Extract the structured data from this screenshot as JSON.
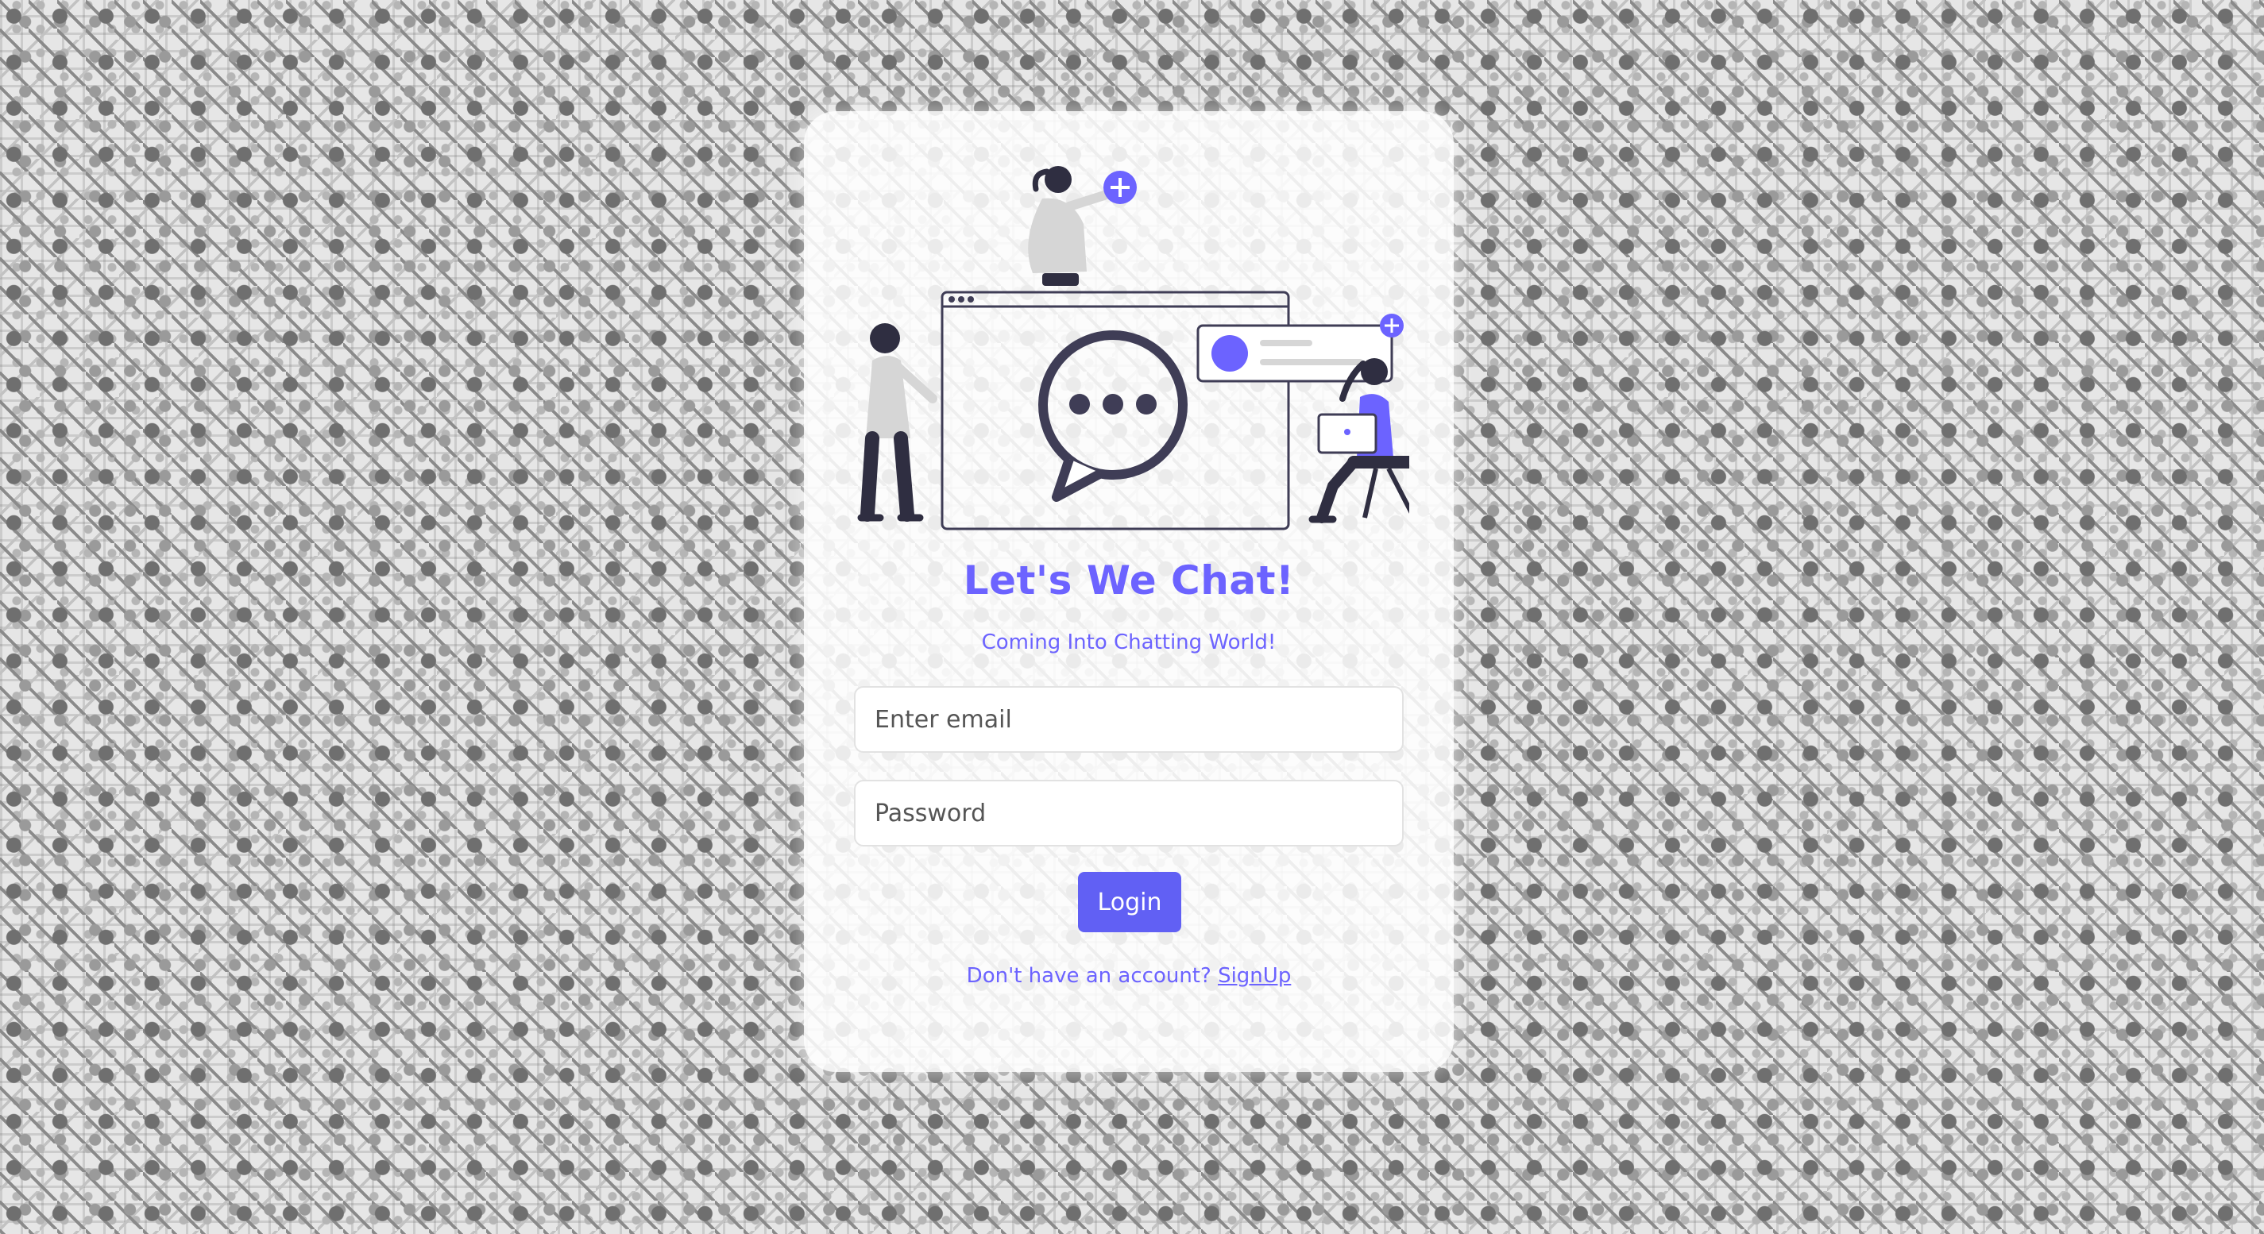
{
  "login": {
    "title": "Let's We Chat!",
    "subtitle": "Coming Into Chatting World!",
    "email_placeholder": "Enter email",
    "password_placeholder": "Password",
    "login_label": "Login",
    "signup_prompt": "Don't have an account?",
    "signup_link": "SignUp"
  },
  "illustration": {
    "icons": [
      "chat-bubble-icon",
      "plus-icon",
      "avatar-dot-icon"
    ]
  },
  "colors": {
    "accent": "#6c63ff",
    "button": "#6160f4",
    "dark": "#3f3d56",
    "light_gray": "#d6d6d6"
  }
}
